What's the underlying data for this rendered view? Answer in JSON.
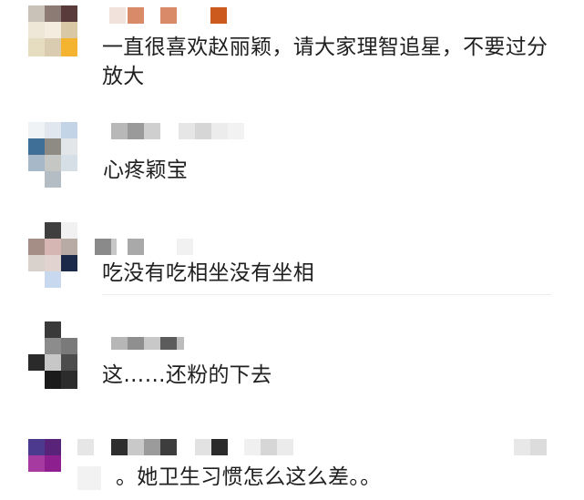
{
  "comments": [
    {
      "text": "一直很喜欢赵丽颖，请大家理智追星，不要过分放大",
      "avatar_colors": [
        "#c8c2b8",
        "#8b7b74",
        "#5a3b3c",
        "#eee6d6",
        "#f3ecdf",
        "#d8c8a4",
        "#e6dcc0",
        "#d9ccb0",
        "#f5b430"
      ],
      "name_colors": [
        "#f1e3dc",
        "#d98a68",
        "#d98a68",
        "#cc5a1e"
      ]
    },
    {
      "text": "心疼颖宝",
      "avatar_colors": [
        "#f0f3f6",
        "#e1e7ee",
        "#c3d4e6",
        "#3f6f96",
        "#8e8a84",
        "#e3e6e8",
        "#a7b8c8",
        "#c4c7c3",
        "#d6dfe5",
        "#ffffff",
        "#b4bcc4",
        "#ffffff"
      ],
      "name_colors": [
        "#b8b8b8",
        "#9a9a9a",
        "#cfcfcf",
        "#e6e6e6",
        "#d6d6d6",
        "#ececec",
        "#f2f2f2"
      ]
    },
    {
      "text": "吃没有吃相坐没有坐相",
      "avatar_colors": [
        "#ffffff",
        "#3f3f3f",
        "#f1f1f1",
        "#a58e86",
        "#d5b6b2",
        "#b8aaa4",
        "#d9d2cc",
        "#e1d4d0",
        "#1c2a4a",
        "#ffffff",
        "#c8d8ee",
        "#ffffff"
      ],
      "name_colors": [
        "#8a8a8a",
        "#c7c7c7",
        "#a9a9a9",
        "#f1f1f1"
      ]
    },
    {
      "text": "这……还粉的下去",
      "avatar_colors": [
        "#ffffff",
        "#3a3a3a",
        "#ffffff",
        "#ffffff",
        "#8c8c8c",
        "#7a7a7a",
        "#2a2a2a",
        "#c7c7c7",
        "#4c4c4c",
        "#ffffff",
        "#1b1b1b",
        "#2c2c2c"
      ],
      "name_colors": [
        "#b6b6b6",
        "#8f8f8f",
        "#c8c8c8",
        "#5c5c5c",
        "#bcbcbc"
      ]
    },
    {
      "text": "。她卫生习惯怎么这么差。。",
      "avatar_colors": [
        "#4c3a8e",
        "#5a237a",
        "#a63aa0",
        "#8e1f8e"
      ],
      "name_colors": [
        "#e6e6e6",
        "#f2f2f2",
        "#2e2e2e",
        "#c9c9c9",
        "#9b9b9b",
        "#3d3d3d",
        "#e2e2e2",
        "#2b2b2b",
        "#f0f0f0",
        "#d6d6d6",
        "#ebebeb",
        "#e8e8e8",
        "#dcdcdc"
      ]
    }
  ]
}
